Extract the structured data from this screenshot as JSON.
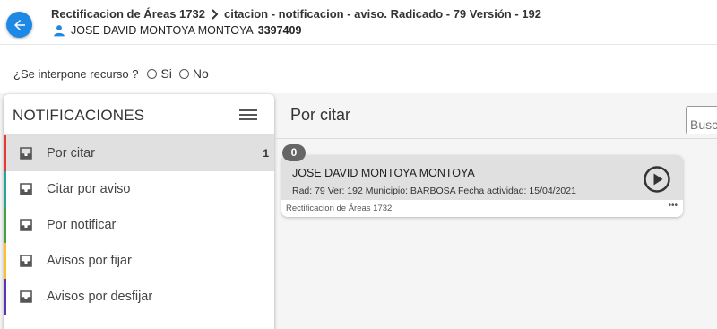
{
  "header": {
    "breadcrumb_process": "Rectificacion de Áreas 1732",
    "breadcrumb_step": "citacion - notificacion - aviso. Radicado - 79 Versión - 192",
    "user_name": "JOSE DAVID MONTOYA MONTOYA",
    "user_id": "3397409"
  },
  "question": {
    "label": "¿Se interpone recurso ?",
    "option_yes": "Si",
    "option_no": "No"
  },
  "sidebar": {
    "title": "NOTIFICACIONES",
    "items": [
      {
        "label": "Por citar",
        "count": "1",
        "color": "#e53935"
      },
      {
        "label": "Citar por aviso",
        "count": "",
        "color": "#26a69a"
      },
      {
        "label": "Por notificar",
        "count": "",
        "color": "#43a047"
      },
      {
        "label": "Avisos por fijar",
        "count": "",
        "color": "#fbc02d"
      },
      {
        "label": "Avisos por desfijar",
        "count": "",
        "color": "#5e35b1"
      }
    ]
  },
  "main": {
    "title": "Por citar",
    "search_placeholder": "Buscar",
    "badge": "0",
    "card": {
      "name": "JOSE DAVID MONTOYA MONTOYA",
      "detail": "Rad: 79 Ver: 192 Municipio: BARBOSA Fecha actividad: 15/04/2021",
      "footer": "Rectificacion de Áreas 1732",
      "more": "•••"
    }
  },
  "colors": {
    "accent": "#1e88e5",
    "active_row": "#e0e0e0",
    "card_header": "#e0e0e0"
  }
}
